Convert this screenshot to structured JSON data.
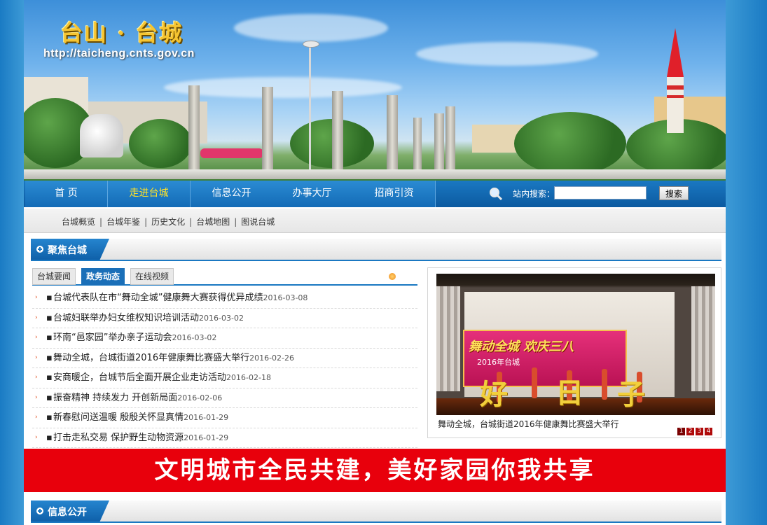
{
  "header": {
    "site_title": "台山 · 台城",
    "site_url": "http://taicheng.cnts.gov.cn"
  },
  "nav": {
    "items": [
      {
        "label": "首  页",
        "active": false
      },
      {
        "label": "走进台城",
        "active": true
      },
      {
        "label": "信息公开",
        "active": false
      },
      {
        "label": "办事大厅",
        "active": false
      },
      {
        "label": "招商引资",
        "active": false
      }
    ],
    "search_label": "站内搜索：",
    "search_value": "",
    "search_button": "搜索",
    "icons": [
      "search-icon"
    ]
  },
  "sublinks": [
    "台城概览",
    "台城年鉴",
    "历史文化",
    "台城地图",
    "图说台城"
  ],
  "focus_section": {
    "title": "聚焦台城",
    "tabs": [
      {
        "label": "台城要闻",
        "active": false
      },
      {
        "label": "政务动态",
        "active": true
      },
      {
        "label": "在线视频",
        "active": false
      }
    ],
    "news": [
      {
        "title": "台城代表队在市“舞动全城”健康舞大赛获得优异成绩",
        "date": "2016-03-08"
      },
      {
        "title": "台城妇联举办妇女维权知识培训活动",
        "date": "2016-03-02"
      },
      {
        "title": "环南“邑家园”举办亲子运动会",
        "date": "2016-03-02"
      },
      {
        "title": "舞动全城，台城街道2016年健康舞比赛盛大举行",
        "date": "2016-02-26"
      },
      {
        "title": "安商暖企，台城节后全面开展企业走访活动",
        "date": "2016-02-18"
      },
      {
        "title": "振奋精神  持续发力  开创新局面",
        "date": "2016-02-06"
      },
      {
        "title": "新春慰问送温暖  殷殷关怀显真情",
        "date": "2016-01-29"
      },
      {
        "title": "打击走私交易  保护野生动物资源",
        "date": "2016-01-29"
      }
    ],
    "photo": {
      "caption": "舞动全城，台城街道2016年健康舞比赛盛大举行",
      "sign_text": "舞动全城 欢庆三八",
      "sign_sub": "2016年台城",
      "big_text": [
        "好",
        "日",
        "子"
      ],
      "pages": [
        "1",
        "2",
        "3",
        "4"
      ],
      "current_page": "1"
    }
  },
  "slogan": "文明城市全民共建，美好家园你我共享",
  "info_section": {
    "title": "信息公开"
  },
  "colors": {
    "nav_blue": "#1a78c2",
    "active_nav_text": "#ffe227",
    "slogan_red": "#e8000c",
    "date_gray": "#555555"
  }
}
